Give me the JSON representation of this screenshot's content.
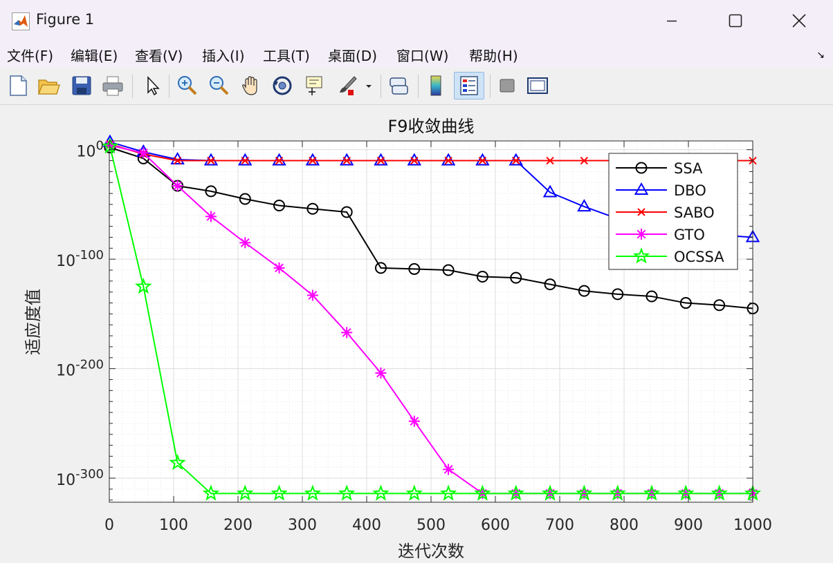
{
  "window": {
    "title": "Figure 1"
  },
  "menu": {
    "items": [
      "文件(F)",
      "编辑(E)",
      "查看(V)",
      "插入(I)",
      "工具(T)",
      "桌面(D)",
      "窗口(W)",
      "帮助(H)"
    ]
  },
  "toolbar": {
    "icons": [
      "new-figure-icon",
      "open-file-icon",
      "save-icon",
      "print-icon",
      "pointer-icon",
      "zoom-in-icon",
      "zoom-out-icon",
      "pan-hand-icon",
      "rotate-3d-icon",
      "data-cursor-icon",
      "brush-icon",
      "link-plot-icon",
      "colorbar-icon",
      "legend-icon",
      "hide-plot-tools-icon",
      "show-plot-tools-icon"
    ]
  },
  "colors": {
    "SSA": "#000000",
    "DBO": "#0000ff",
    "SABO": "#ff0000",
    "GTO": "#ff00ff",
    "OCSSA": "#00ff00"
  },
  "chart_data": {
    "type": "line",
    "title": "F9收敛曲线",
    "xlabel": "迭代次数",
    "ylabel": "适应度值",
    "xlim": [
      0,
      1000
    ],
    "ylim_log10": [
      -322,
      8
    ],
    "yscale": "log",
    "grid": true,
    "minor_grid": true,
    "legend_position": "top-right",
    "xticks": [
      0,
      100,
      200,
      300,
      400,
      500,
      600,
      700,
      800,
      900,
      1000
    ],
    "yticks": [
      {
        "base": "10",
        "exp": "0",
        "log10": 0
      },
      {
        "base": "10",
        "exp": "-100",
        "log10": -100
      },
      {
        "base": "10",
        "exp": "-200",
        "log10": -200
      },
      {
        "base": "10",
        "exp": "-300",
        "log10": -300
      }
    ],
    "x": [
      1,
      53,
      106,
      158,
      211,
      264,
      316,
      369,
      422,
      474,
      527,
      580,
      632,
      685,
      738,
      790,
      843,
      896,
      948,
      1000
    ],
    "series": [
      {
        "name": "SSA",
        "marker": "circle",
        "log10_values": [
          2,
          -8,
          -33,
          -38,
          -45,
          -51,
          -54,
          -57,
          -108,
          -109,
          -110,
          -116,
          -117,
          -123,
          -129,
          -132,
          -134,
          -140,
          -142,
          -145
        ]
      },
      {
        "name": "DBO",
        "marker": "triangle",
        "log10_values": [
          7,
          -2,
          -9,
          -10,
          -10,
          -10,
          -10,
          -10,
          -10,
          -10,
          -10,
          -10,
          -10,
          -39,
          -52,
          -63,
          -69,
          -75,
          -78,
          -80
        ]
      },
      {
        "name": "SABO",
        "marker": "x",
        "log10_values": [
          5,
          -4,
          -10,
          -10,
          -10,
          -10,
          -10,
          -10,
          -10,
          -10,
          -10,
          -10,
          -10,
          -10,
          -10,
          -10,
          -10,
          -10,
          -10,
          -10
        ]
      },
      {
        "name": "GTO",
        "marker": "star",
        "log10_values": [
          4,
          -3,
          -33,
          -61,
          -85,
          -108,
          -133,
          -167,
          -204,
          -248,
          -292,
          -314,
          -314,
          -314,
          -314,
          -314,
          -314,
          -314,
          -314,
          -314
        ]
      },
      {
        "name": "OCSSA",
        "marker": "pentagram",
        "log10_values": [
          3,
          -125,
          -286,
          -314,
          -314,
          -314,
          -314,
          -314,
          -314,
          -314,
          -314,
          -314,
          -314,
          -314,
          -314,
          -314,
          -314,
          -314,
          -314,
          -314
        ]
      }
    ]
  }
}
